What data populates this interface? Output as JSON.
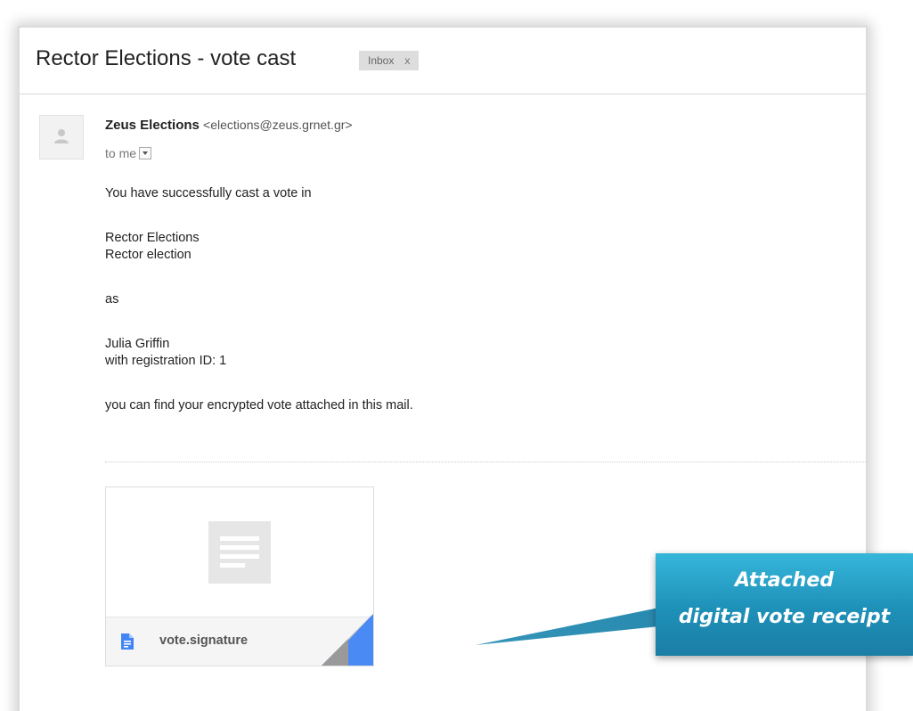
{
  "email": {
    "subject": "Rector Elections - vote cast",
    "label": "Inbox",
    "label_close": "x",
    "sender_name": "Zeus Elections",
    "sender_email": "<elections@zeus.grnet.gr>",
    "recipient": "to me",
    "body_lines": [
      "You have successfully cast a vote in",
      "Rector Elections",
      "Rector election",
      "as",
      "Julia Griffin",
      "with registration ID: 1",
      "you can find your encrypted vote attached in this mail."
    ]
  },
  "attachment": {
    "filename": "vote.signature",
    "icon": "document-icon"
  },
  "callout": {
    "line1": "Attached",
    "line2": "digital vote receipt"
  },
  "colors": {
    "callout_top": "#36b6db",
    "callout_bottom": "#1b7ea5",
    "doc_icon_blue": "#4285f4",
    "label_bg": "#dddddd"
  }
}
